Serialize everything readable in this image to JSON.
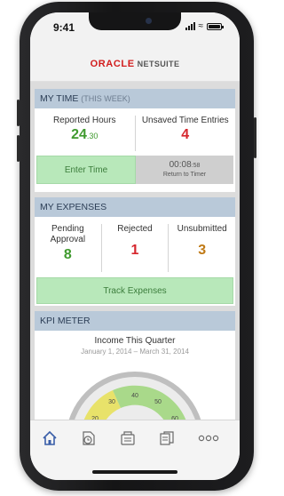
{
  "status_bar": {
    "time": "9:41"
  },
  "brand": {
    "oracle": "ORACLE",
    "netsuite": "NETSUITE"
  },
  "my_time": {
    "title": "MY TIME",
    "subtitle": "(THIS WEEK)",
    "reported_label": "Reported Hours",
    "reported_value": "24",
    "reported_decimal": ".30",
    "unsaved_label": "Unsaved Time Entries",
    "unsaved_value": "4",
    "enter_time_label": "Enter Time",
    "timer_value": "00:08",
    "timer_seconds": ":58",
    "return_label": "Return to Timer"
  },
  "my_expenses": {
    "title": "MY EXPENSES",
    "pending_label_1": "Pending",
    "pending_label_2": "Approval",
    "pending_value": "8",
    "rejected_label": "Rejected",
    "rejected_value": "1",
    "unsubmitted_label": "Unsubmitted",
    "unsubmitted_value": "3",
    "track_label": "Track Expenses"
  },
  "kpi": {
    "title": "KPI METER",
    "meter_title": "Income This Quarter",
    "date_range": "January 1, 2014 – March 31, 2014",
    "tick_labels": [
      "20",
      "30",
      "40",
      "50",
      "60"
    ]
  },
  "tabs": [
    {
      "icon": "home-icon"
    },
    {
      "icon": "time-icon"
    },
    {
      "icon": "calculator-icon"
    },
    {
      "icon": "documents-icon"
    },
    {
      "icon": "more-icon"
    }
  ],
  "colors": {
    "header_bg": "#b9c9d9",
    "positive": "#3f9a2e",
    "negative": "#d6262d",
    "warning": "#c07a16",
    "action_bg": "#b8e8ba",
    "brand_red": "#d21d1d"
  }
}
